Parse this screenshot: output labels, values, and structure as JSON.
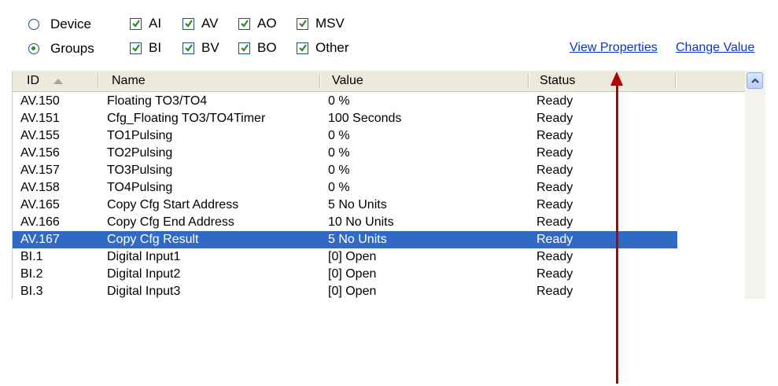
{
  "radios": [
    {
      "label": "Device",
      "selected": false
    },
    {
      "label": "Groups",
      "selected": true
    }
  ],
  "checkboxes": [
    {
      "label": "AI",
      "checked": true
    },
    {
      "label": "AV",
      "checked": true
    },
    {
      "label": "AO",
      "checked": true
    },
    {
      "label": "MSV",
      "checked": true
    },
    {
      "label": "BI",
      "checked": true
    },
    {
      "label": "BV",
      "checked": true
    },
    {
      "label": "BO",
      "checked": true
    },
    {
      "label": "Other",
      "checked": true
    }
  ],
  "links": {
    "view_properties": "View Properties",
    "change_value": "Change Value"
  },
  "columns": [
    "ID",
    "Name",
    "Value",
    "Status"
  ],
  "rows": [
    {
      "id": "AV.150",
      "name": "Floating TO3/TO4",
      "value": "0 %",
      "status": "Ready"
    },
    {
      "id": "AV.151",
      "name": "Cfg_Floating TO3/TO4Timer",
      "value": "100 Seconds",
      "status": "Ready"
    },
    {
      "id": "AV.155",
      "name": "TO1Pulsing",
      "value": "0 %",
      "status": "Ready"
    },
    {
      "id": "AV.156",
      "name": "TO2Pulsing",
      "value": "0 %",
      "status": "Ready"
    },
    {
      "id": "AV.157",
      "name": "TO3Pulsing",
      "value": "0 %",
      "status": "Ready"
    },
    {
      "id": "AV.158",
      "name": "TO4Pulsing",
      "value": "0 %",
      "status": "Ready"
    },
    {
      "id": "AV.165",
      "name": "Copy Cfg Start Address",
      "value": "5 No Units",
      "status": "Ready"
    },
    {
      "id": "AV.166",
      "name": "Copy Cfg End Address",
      "value": "10 No Units",
      "status": "Ready"
    },
    {
      "id": "AV.167",
      "name": "Copy Cfg Result",
      "value": "5 No Units",
      "status": "Ready",
      "selected": true
    },
    {
      "id": "BI.1",
      "name": "Digital Input1",
      "value": "[0] Open",
      "status": "Ready"
    },
    {
      "id": "BI.2",
      "name": "Digital Input2",
      "value": "[0] Open",
      "status": "Ready"
    },
    {
      "id": "BI.3",
      "name": "Digital Input3",
      "value": "[0] Open",
      "status": "Ready"
    }
  ],
  "colors": {
    "selection": "#316ac5",
    "link": "#0b35c7",
    "annotation_arrow": "#b30000",
    "check": "#2a8a2a"
  }
}
